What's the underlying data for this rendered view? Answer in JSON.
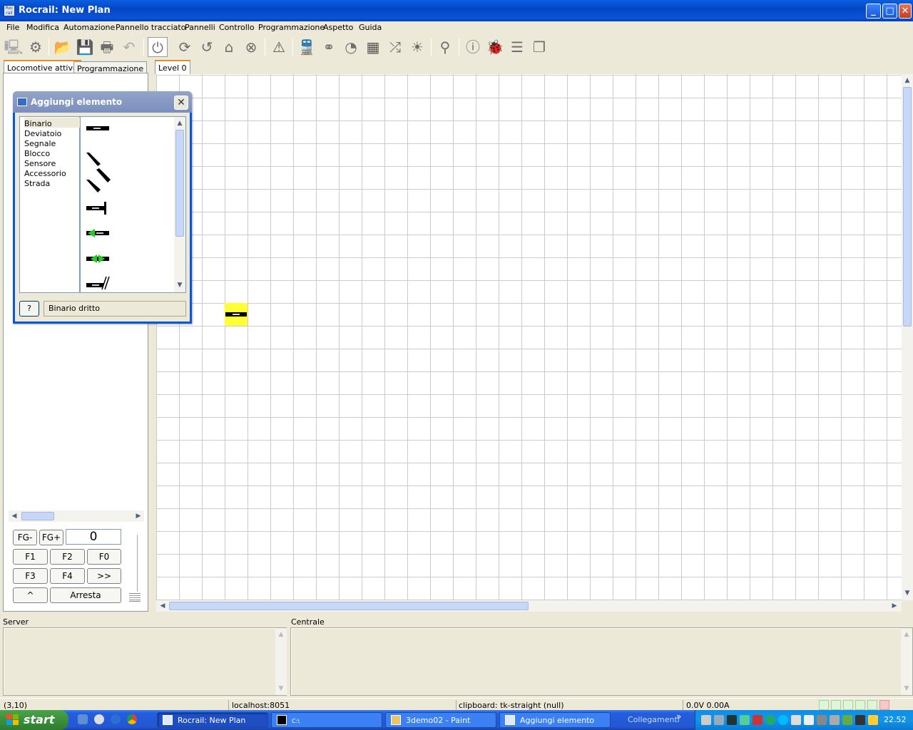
{
  "window": {
    "title": "Rocrail: New Plan",
    "app_icon_text": "Roc rail"
  },
  "menu": [
    "File",
    "Modifica",
    "Automazione",
    "Pannello tracciato",
    "Pannelli",
    "Controllo",
    "Programmazione",
    "Aspetto",
    "Guida"
  ],
  "toolbar": {
    "icons": [
      "server-icon",
      "settings-icon",
      "open-folder-icon",
      "save-icon",
      "print-icon",
      "undo-icon",
      "power-icon",
      "sync-icon",
      "rotate-icon",
      "home-icon",
      "stop-icon",
      "warning-icon",
      "locomotive-icon",
      "decoder-icon",
      "speedometer-icon",
      "grid-icon",
      "shuffle-icon",
      "light-icon",
      "zoom-icon",
      "info-icon",
      "bug-icon",
      "document-icon",
      "copy-icon"
    ]
  },
  "left_panel": {
    "tabs": [
      "Locomotive attive",
      "Programmazione"
    ],
    "controls": {
      "fg_minus": "FG-",
      "fg_plus": "FG+",
      "speed_value": "0",
      "f1": "F1",
      "f2": "F2",
      "f0": "F0",
      "f3": "F3",
      "f4": "F4",
      "more": ">>",
      "direction": "^",
      "stop": "Arresta"
    }
  },
  "plan": {
    "tab": "Level 0",
    "selected_item": "tk-straight"
  },
  "dialog": {
    "title": "Aggiungi elemento",
    "categories": [
      "Binario",
      "Deviatoio",
      "Segnale",
      "Blocco",
      "Sensore",
      "Accessorio",
      "Strada"
    ],
    "selected_category": "Binario",
    "items": [
      "straight-track",
      "curve-track",
      "curve-track-alt",
      "buffer-stop",
      "direction-track",
      "bidirectional-track",
      "crossing-track"
    ],
    "help_label": "?",
    "description": "Binario dritto"
  },
  "bottom": {
    "server_label": "Server",
    "central_label": "Centrale"
  },
  "status": {
    "coords": "(3,10)",
    "host": "localhost:8051",
    "clipboard": "clipboard: tk-straight (null)",
    "power": "0.0V 0.00A"
  },
  "taskbar": {
    "start": "start",
    "tasks": [
      "Rocrail: New Plan",
      "C:\\",
      "3demo02 - Paint",
      "Aggiungi elemento"
    ],
    "links": "Collegamenti",
    "links_chevron": "»",
    "clock": "22.52"
  },
  "colors": {
    "selected_track": "#ffff33",
    "grid": "#cbcbcb",
    "arrow_green": "#22cc22"
  }
}
